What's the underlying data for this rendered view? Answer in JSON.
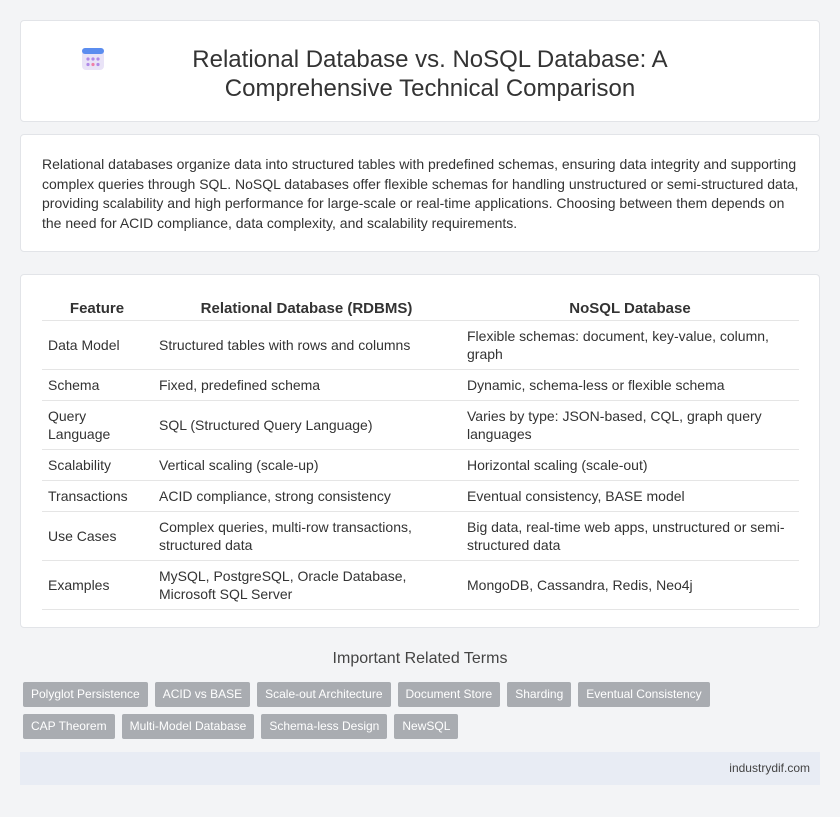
{
  "page": {
    "title": "Relational Database vs. NoSQL Database: A Comprehensive Technical Comparison",
    "title_icon": "calendar-grid-icon",
    "intro": "Relational databases organize data into structured tables with predefined schemas, ensuring data integrity and supporting complex queries through SQL. NoSQL databases offer flexible schemas for handling unstructured or semi-structured data, providing scalability and high performance for large-scale or real-time applications. Choosing between them depends on the need for ACID compliance, data complexity, and scalability requirements."
  },
  "table": {
    "headers": [
      "Feature",
      "Relational Database (RDBMS)",
      "NoSQL Database"
    ],
    "rows": [
      [
        "Data Model",
        "Structured tables with rows and columns",
        "Flexible schemas: document, key-value, column, graph"
      ],
      [
        "Schema",
        "Fixed, predefined schema",
        "Dynamic, schema-less or flexible schema"
      ],
      [
        "Query Language",
        "SQL (Structured Query Language)",
        "Varies by type: JSON-based, CQL, graph query languages"
      ],
      [
        "Scalability",
        "Vertical scaling (scale-up)",
        "Horizontal scaling (scale-out)"
      ],
      [
        "Transactions",
        "ACID compliance, strong consistency",
        "Eventual consistency, BASE model"
      ],
      [
        "Use Cases",
        "Complex queries, multi-row transactions, structured data",
        "Big data, real-time web apps, unstructured or semi-structured data"
      ],
      [
        "Examples",
        "MySQL, PostgreSQL, Oracle Database, Microsoft SQL Server",
        "MongoDB, Cassandra, Redis, Neo4j"
      ]
    ]
  },
  "related": {
    "heading": "Important Related Terms",
    "tags": [
      "Polyglot Persistence",
      "ACID vs BASE",
      "Scale-out Architecture",
      "Document Store",
      "Sharding",
      "Eventual Consistency",
      "CAP Theorem",
      "Multi-Model Database",
      "Schema-less Design",
      "NewSQL"
    ]
  },
  "footer": {
    "site": "industrydif.com"
  },
  "colors": {
    "background": "#f3f4f6",
    "card": "#ffffff",
    "tag": "#a9acb1",
    "footer": "#e8ecf4"
  }
}
